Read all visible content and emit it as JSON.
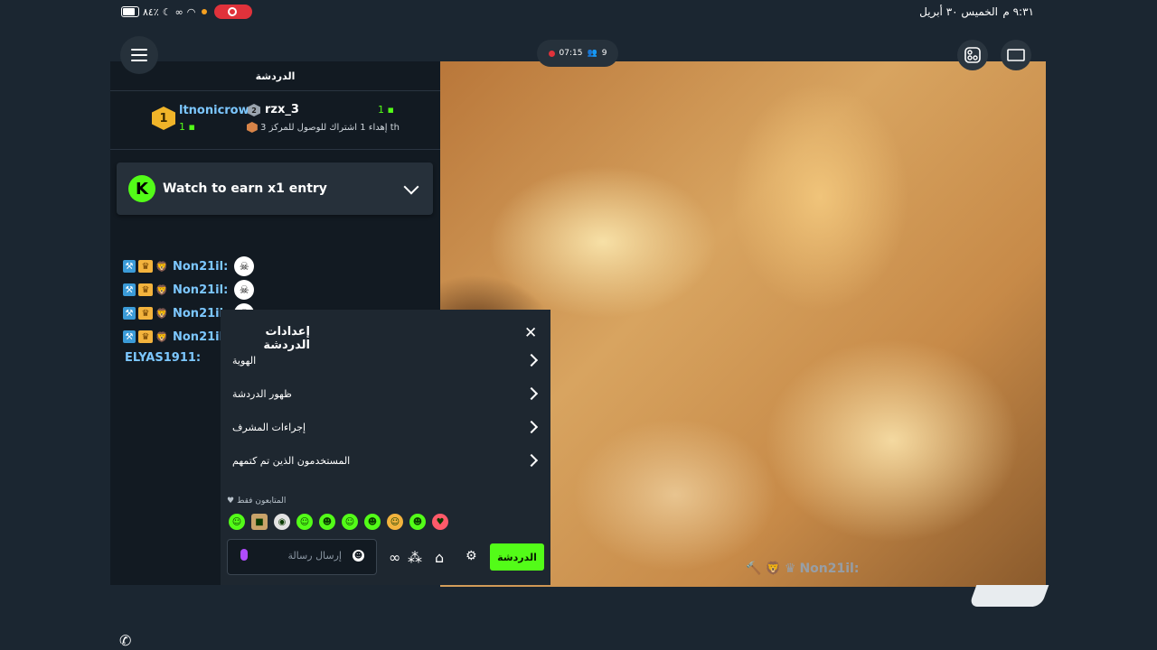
{
  "status_bar": {
    "time": "٩:٣١ م",
    "date": "الخميس ٣٠ أبريل",
    "battery": "٨٤٪"
  },
  "stream": {
    "rec_time": "07:15",
    "viewers": "9"
  },
  "chat": {
    "header": "الدردشة",
    "leaders": [
      {
        "rank": "1",
        "name": "ltnonicrow",
        "count": "1"
      },
      {
        "rank": "2",
        "name": "rzx_3",
        "count": "1"
      }
    ],
    "gift_text": "إهداء 1 اشتراك للوصول للمركز 3",
    "gift_suffix": "th",
    "earn_banner": "Watch to earn x1 entry",
    "lines": [
      {
        "user": "Non21il:"
      },
      {
        "user": "Non21il:"
      },
      {
        "user": "Non21il:"
      },
      {
        "user": "Non21il:"
      }
    ],
    "partial_user": "ELYAS1911:"
  },
  "settings": {
    "title": "إعدادات الدردشة",
    "items": [
      {
        "label": "الهوية"
      },
      {
        "label": "ظهور الدردشة"
      },
      {
        "label": "إجراءات المشرف"
      },
      {
        "label": "المستخدمون الذين تم كتمهم"
      }
    ],
    "followers_only": "المتابعون فقط"
  },
  "composer": {
    "placeholder": "إرسال رسالة",
    "send_button": "الدردشة"
  },
  "overlay": {
    "user": "Non21il:"
  },
  "colors": {
    "accent": "#53fc18",
    "background": "#121a22"
  }
}
